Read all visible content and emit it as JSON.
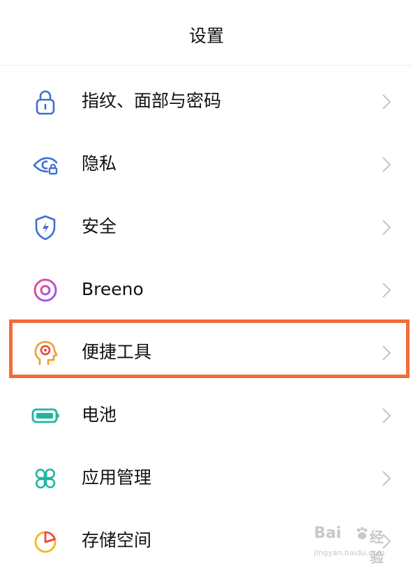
{
  "header": {
    "title": "设置"
  },
  "items": [
    {
      "label": "指纹、面部与密码",
      "icon": "lock-icon"
    },
    {
      "label": "隐私",
      "icon": "privacy-eye-lock-icon"
    },
    {
      "label": "安全",
      "icon": "security-shield-icon"
    },
    {
      "label": "Breeno",
      "icon": "breeno-ring-icon"
    },
    {
      "label": "便捷工具",
      "icon": "convenience-tools-head-icon"
    },
    {
      "label": "电池",
      "icon": "battery-icon"
    },
    {
      "label": "应用管理",
      "icon": "app-management-grid-icon"
    },
    {
      "label": "存储空间",
      "icon": "storage-pie-icon"
    }
  ],
  "highlight": {
    "target": "便捷工具",
    "color": "#f26c3a"
  },
  "colors": {
    "blue_icon": "#3f6fd2",
    "breeno_gradient": [
      "#f44a8b",
      "#8d5af7"
    ],
    "tools_orange": "#f29b29",
    "tools_red": "#e8453c",
    "battery_teal": "#1fb59e",
    "storage_yellow": "#f6b51b",
    "storage_red": "#ee4b3b",
    "chevron": "#c4c4c4"
  },
  "watermark": {
    "brand": "Bai",
    "brand2": "经验",
    "url": "jingyan.baidu.com"
  }
}
